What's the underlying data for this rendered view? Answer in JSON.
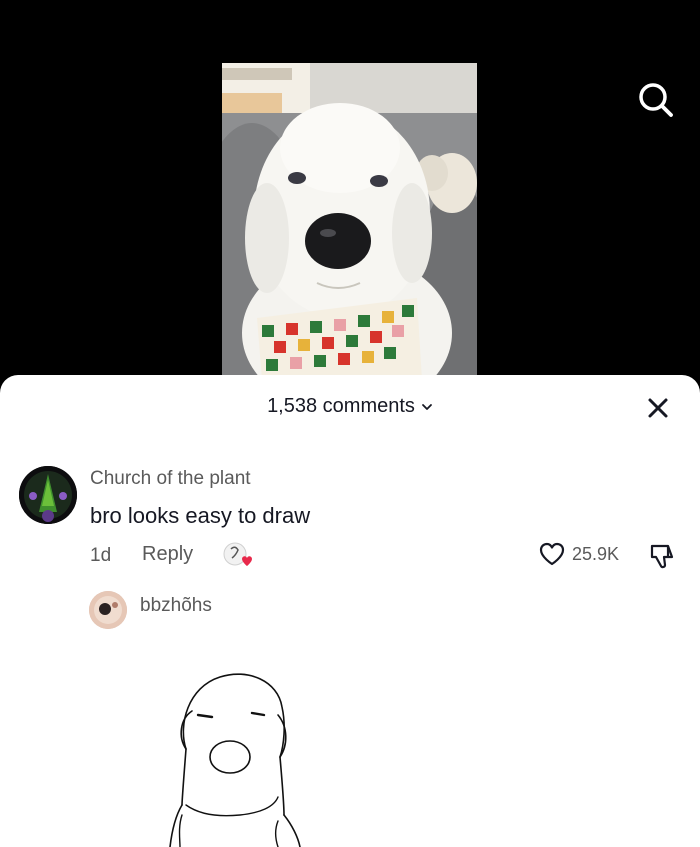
{
  "video": {
    "search_icon": "search-icon",
    "thumbnail": "white fluffy dog with checkered bandana"
  },
  "comments_panel": {
    "count_label": "1,538 comments",
    "close_icon": "close-icon"
  },
  "comment": {
    "username": "Church of the plant",
    "text": "bro looks easy to draw",
    "time": "1d",
    "reply_label": "Reply",
    "like_count": "25.9K"
  },
  "reply": {
    "username": "bbzhõhs",
    "attachment": "line drawing of dog"
  },
  "colors": {
    "background": "#000000",
    "sheet": "#ffffff",
    "text_primary": "#161823",
    "text_secondary": "#5a5a5a",
    "heart_red": "#e8294b"
  }
}
